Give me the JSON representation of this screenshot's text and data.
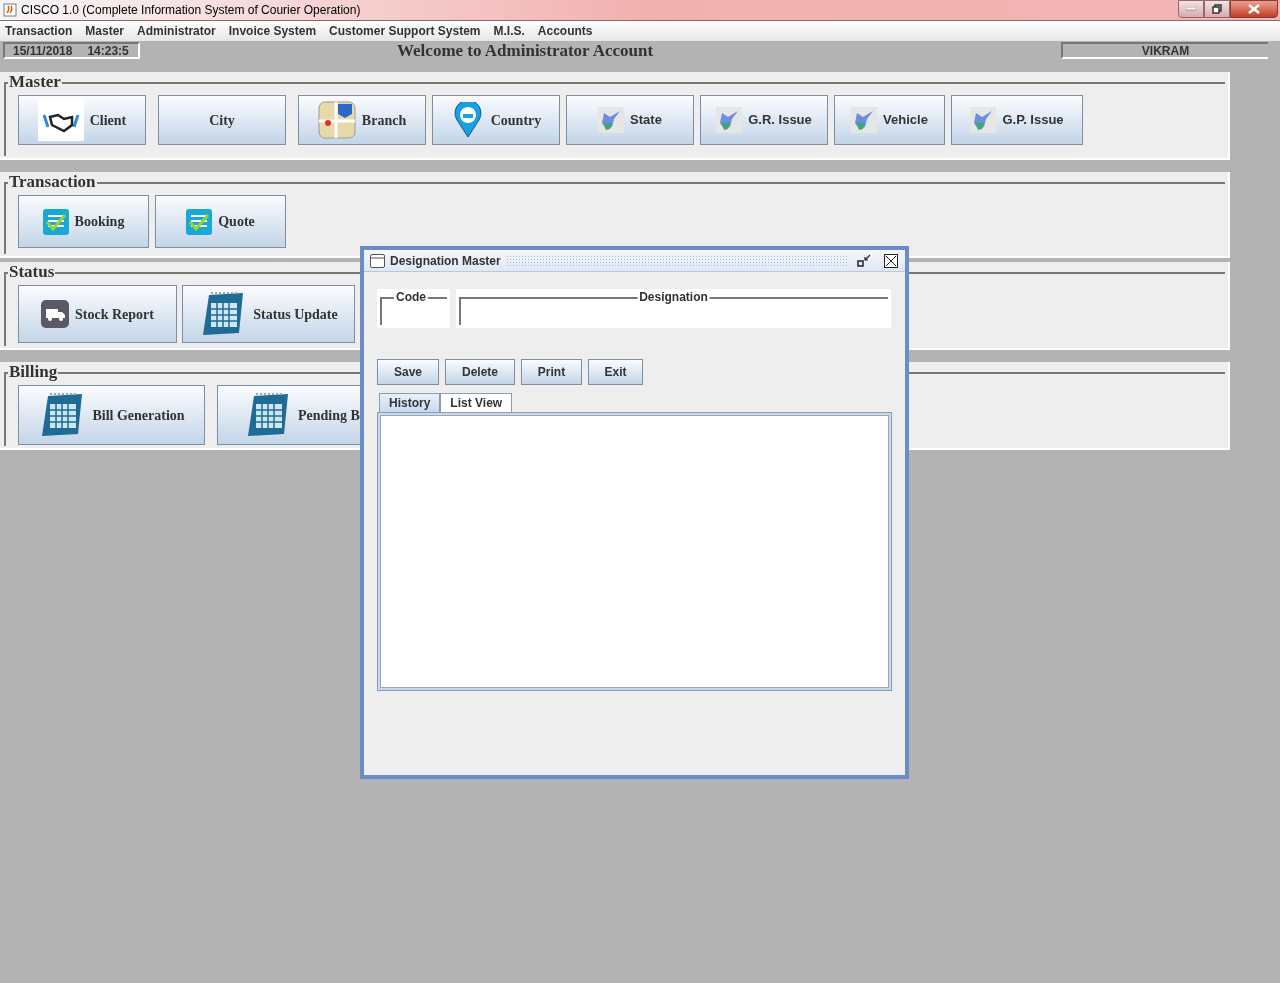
{
  "window": {
    "title": "CISCO 1.0 (Complete Information System of Courier Operation)"
  },
  "menu": [
    "Transaction",
    "Master",
    "Administrator",
    "Invoice System",
    "Customer Support System",
    "M.I.S.",
    "Accounts"
  ],
  "header": {
    "date": "15/11/2018",
    "time": "14:23:5",
    "welcome": "Welcome to Administrator Account",
    "user": "VIKRAM"
  },
  "panels": [
    {
      "title": "Master",
      "buttons": [
        {
          "label": "Client",
          "kind": "handshake"
        },
        {
          "label": "City",
          "kind": "plain"
        },
        {
          "label": "Branch",
          "kind": "map"
        },
        {
          "label": "Country",
          "kind": "pin"
        },
        {
          "label": "State",
          "kind": "region"
        },
        {
          "label": "G.R. Issue",
          "kind": "region"
        },
        {
          "label": "Vehicle",
          "kind": "region"
        },
        {
          "label": "G.P. Issue",
          "kind": "region"
        }
      ]
    },
    {
      "title": "Transaction",
      "buttons": [
        {
          "label": "Booking",
          "kind": "checklist"
        },
        {
          "label": "Quote",
          "kind": "checklist"
        }
      ]
    },
    {
      "title": "Status",
      "buttons": [
        {
          "label": "Stock Report",
          "kind": "truck"
        },
        {
          "label": "Status Update",
          "kind": "calendar"
        }
      ]
    },
    {
      "title": "Billing",
      "buttons": [
        {
          "label": "Bill Generation",
          "kind": "calendar"
        },
        {
          "label": "Pending B",
          "kind": "calendar"
        }
      ]
    }
  ],
  "dialog": {
    "title": "Designation Master",
    "fields": [
      {
        "label": "Code"
      },
      {
        "label": "Designation"
      }
    ],
    "buttons": [
      "Save",
      "Delete",
      "Print",
      "Exit"
    ],
    "tabs": [
      {
        "label": "History",
        "selected": true
      },
      {
        "label": "List View",
        "selected": false
      }
    ]
  }
}
